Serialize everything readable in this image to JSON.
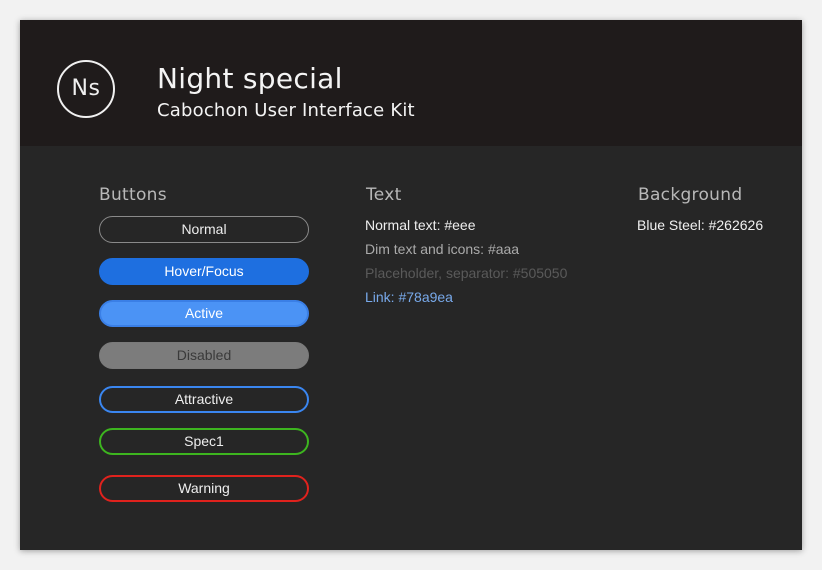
{
  "header": {
    "logo_text": "Ns",
    "title": "Night special",
    "subtitle": "Cabochon User Interface Kit"
  },
  "sections": {
    "buttons": {
      "title": "Buttons",
      "items": [
        {
          "label": "Normal",
          "state": "normal"
        },
        {
          "label": "Hover/Focus",
          "state": "hover"
        },
        {
          "label": "Active",
          "state": "active"
        },
        {
          "label": "Disabled",
          "state": "disabled"
        },
        {
          "label": "Attractive",
          "state": "attractive"
        },
        {
          "label": "Spec1",
          "state": "spec1"
        },
        {
          "label": "Warning",
          "state": "warning"
        }
      ]
    },
    "text": {
      "title": "Text",
      "normal": "Normal text: #eee",
      "dim": "Dim text and icons: #aaa",
      "placeholder": "Placeholder, separator: #505050",
      "link": "Link: #78a9ea"
    },
    "background": {
      "title": "Background",
      "blue_steel": "Blue Steel: #262626"
    }
  },
  "colors": {
    "background": "#262626",
    "header": "#1f1b1b",
    "text_normal": "#eeeeee",
    "text_dim": "#aaaaaa",
    "placeholder": "#505050",
    "link": "#78a9ea",
    "hover": "#1e6fe0",
    "active": "#4b93f5",
    "attractive": "#3a86f0",
    "spec1": "#3db51f",
    "warning": "#e0221d"
  }
}
